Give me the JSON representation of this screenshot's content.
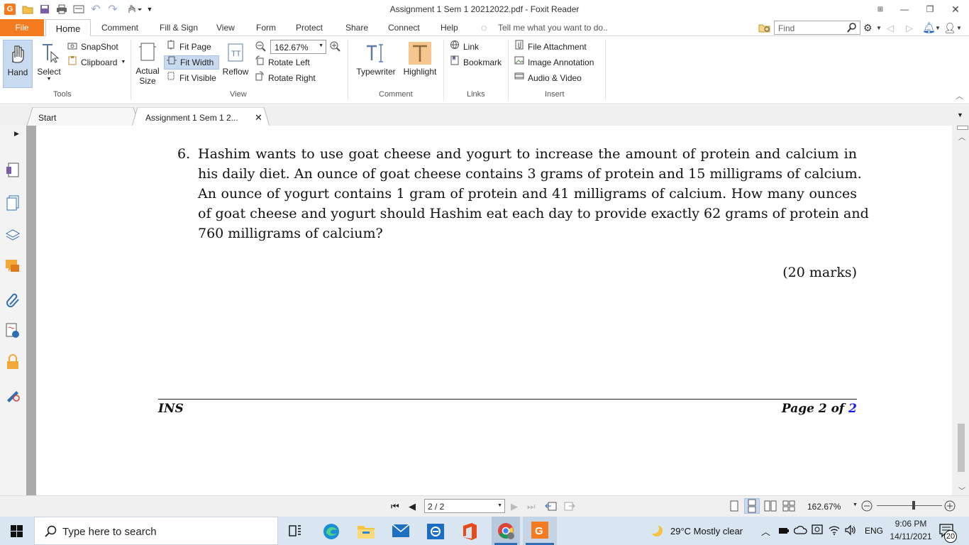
{
  "window": {
    "title": "Assignment 1 Sem 1 20212022.pdf - Foxit Reader"
  },
  "menu": {
    "file": "File",
    "home": "Home",
    "comment": "Comment",
    "fill_sign": "Fill & Sign",
    "view": "View",
    "form": "Form",
    "protect": "Protect",
    "share": "Share",
    "connect": "Connect",
    "help": "Help",
    "tell_me": "Tell me what you want to do..",
    "find_placeholder": "Find"
  },
  "ribbon": {
    "hand": "Hand",
    "select": "Select",
    "snapshot": "SnapShot",
    "clipboard": "Clipboard",
    "tools_group": "Tools",
    "actual_size_1": "Actual",
    "actual_size_2": "Size",
    "fit_page": "Fit Page",
    "fit_width": "Fit Width",
    "fit_visible": "Fit Visible",
    "reflow": "Reflow",
    "zoom_value": "162.67%",
    "rotate_left": "Rotate Left",
    "rotate_right": "Rotate Right",
    "view_group": "View",
    "typewriter": "Typewriter",
    "highlight": "Highlight",
    "comment_group": "Comment",
    "link": "Link",
    "bookmark": "Bookmark",
    "links_group": "Links",
    "file_attachment": "File Attachment",
    "image_annotation": "Image Annotation",
    "audio_video": "Audio & Video",
    "insert_group": "Insert"
  },
  "tabs": [
    {
      "label": "Start"
    },
    {
      "label": "Assignment 1 Sem 1 2..."
    }
  ],
  "document": {
    "question_number": "6.",
    "lines": [
      "Hashim wants to use goat cheese and yogurt to increase the amount of protein and calcium in",
      "his daily diet. An ounce of goat cheese contains 3 grams of protein and 15 milligrams of calcium.",
      "An ounce of yogurt contains 1 gram of protein and 41 milligrams of calcium. How many ounces",
      "of goat cheese and yogurt should Hashim eat each day to provide exactly 62 grams of protein and",
      "760 milligrams of calcium?"
    ],
    "marks": "(20 marks)",
    "footer_left": "INS",
    "footer_right_prefix": "Page 2 of ",
    "footer_right_link": "2"
  },
  "status": {
    "page_indicator": "2 / 2",
    "zoom": "162.67%"
  },
  "taskbar": {
    "search_placeholder": "Type here to search",
    "weather": "29°C  Mostly clear",
    "lang": "ENG",
    "time": "9:06 PM",
    "date": "14/11/2021",
    "notifications": "20"
  },
  "colors": {
    "accent": "#f47b20",
    "link": "#1a1aff",
    "taskbar": "#d9e5f1"
  }
}
